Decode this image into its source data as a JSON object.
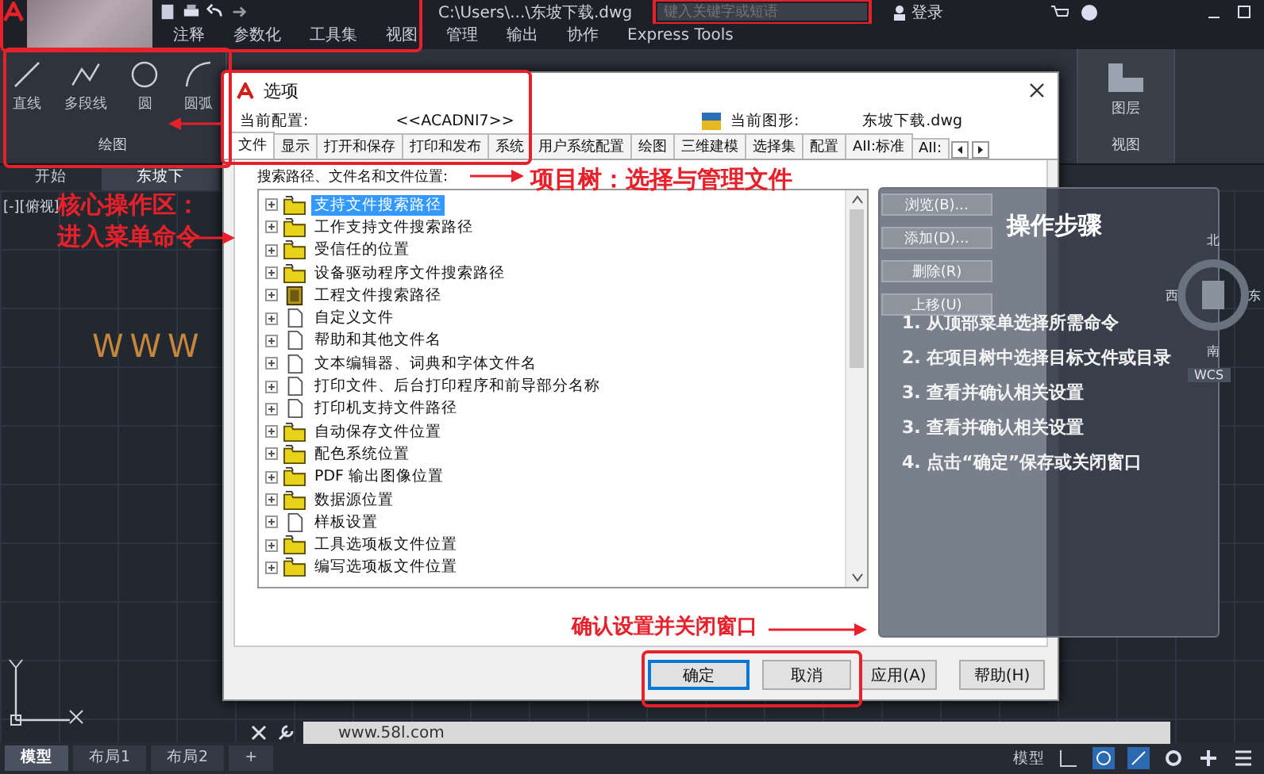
{
  "app": {
    "title": "C:\\Users\\...\\东坡下载.dwg",
    "search_placeholder": "键入关键字或短语",
    "login": "登录"
  },
  "ribbon_tabs": [
    {
      "label": "注释",
      "selected": false
    },
    {
      "label": "参数化",
      "selected": false
    },
    {
      "label": "工具集",
      "selected": false
    },
    {
      "label": "视图",
      "selected": false
    },
    {
      "label": "管理",
      "selected": false
    },
    {
      "label": "输出",
      "selected": false
    },
    {
      "label": "协作",
      "selected": false
    },
    {
      "label": "Express Tools",
      "selected": false
    }
  ],
  "draw_tools": [
    {
      "label": "直线",
      "kind": "line"
    },
    {
      "label": "多段线",
      "kind": "polyline"
    },
    {
      "label": "圆",
      "kind": "circle"
    },
    {
      "label": "圆弧",
      "kind": "arc"
    }
  ],
  "draw_panel": "绘图",
  "view_panel": {
    "button": "图层",
    "label": "视图"
  },
  "file_tabs": [
    {
      "label": "开始",
      "selected": false
    },
    {
      "label": "东坡下",
      "selected": true
    }
  ],
  "viewport_label": "[-][俯视]",
  "canvas_text": "WWW",
  "dialog": {
    "title": "选项",
    "profile_label": "当前配置:",
    "profile": "<<ACADNI7>>",
    "drawing_label": "当前图形:",
    "drawing": "东坡下载.dwg",
    "tabs": [
      {
        "label": "文件",
        "selected": true
      },
      {
        "label": "显示",
        "selected": false
      },
      {
        "label": "打开和保存",
        "selected": false
      },
      {
        "label": "打印和发布",
        "selected": false
      },
      {
        "label": "系统",
        "selected": false
      },
      {
        "label": "用户系统配置",
        "selected": false
      },
      {
        "label": "绘图",
        "selected": false
      },
      {
        "label": "三维建模",
        "selected": false
      },
      {
        "label": "选择集",
        "selected": false
      },
      {
        "label": "配置",
        "selected": false
      },
      {
        "label": "AII:标准",
        "selected": false
      },
      {
        "label": "AII:",
        "selected": false
      }
    ],
    "tree_label": "搜索路径、文件名和文件位置:",
    "tree": [
      {
        "label": "支持文件搜索路径",
        "kind": "folder",
        "selected": true
      },
      {
        "label": "工作支持文件搜索路径",
        "kind": "folder",
        "selected": false
      },
      {
        "label": "受信任的位置",
        "kind": "folder",
        "selected": false
      },
      {
        "label": "设备驱动程序文件搜索路径",
        "kind": "folder",
        "selected": false
      },
      {
        "label": "工程文件搜索路径",
        "kind": "book",
        "selected": false
      },
      {
        "label": "自定义文件",
        "kind": "doc",
        "selected": false
      },
      {
        "label": "帮助和其他文件名",
        "kind": "doc",
        "selected": false
      },
      {
        "label": "文本编辑器、词典和字体文件名",
        "kind": "doc",
        "selected": false
      },
      {
        "label": "打印文件、后台打印程序和前导部分名称",
        "kind": "doc",
        "selected": false
      },
      {
        "label": "打印机支持文件路径",
        "kind": "doc",
        "selected": false
      },
      {
        "label": "自动保存文件位置",
        "kind": "folder",
        "selected": false
      },
      {
        "label": "配色系统位置",
        "kind": "folder",
        "selected": false
      },
      {
        "label": "PDF 输出图像位置",
        "kind": "folder",
        "selected": false
      },
      {
        "label": "数据源位置",
        "kind": "folder",
        "selected": false
      },
      {
        "label": "样板设置",
        "kind": "doc",
        "selected": false
      },
      {
        "label": "工具选项板文件位置",
        "kind": "folder",
        "selected": false
      },
      {
        "label": "编写选项板文件位置",
        "kind": "folder",
        "selected": false
      }
    ],
    "side_buttons": [
      "浏览(B)...",
      "添加(D)...",
      "删除(R)",
      "上移(U)"
    ],
    "buttons": [
      {
        "label": "确定",
        "kind": "default"
      },
      {
        "label": "取消",
        "kind": "normal"
      },
      {
        "label": "应用(A)",
        "kind": "normal"
      },
      {
        "label": "帮助(H)",
        "kind": "normal"
      }
    ]
  },
  "steps_panel": {
    "title": "操作步骤",
    "steps": [
      "1. 从顶部菜单选择所需命令",
      "2. 在项目树中选择目标文件或目录",
      "3. 查看并确认相关设置",
      "3. 查看并确认相关设置",
      "4. 点击“确定”保存或关闭窗口"
    ]
  },
  "annotations": {
    "core_area": "核心操作区：",
    "core_area_hint": "进入菜单命令",
    "project_tree": "项目树：选择与管理文件",
    "confirm": "确认设置并关闭窗口"
  },
  "viewcube": {
    "north": "北",
    "west": "西",
    "east": "东",
    "south": "南",
    "wcs": "WCS"
  },
  "command_line": "www.58l.com",
  "layout_tabs": [
    {
      "label": "模型",
      "selected": true
    },
    {
      "label": "布局1",
      "selected": false
    },
    {
      "label": "布局2",
      "selected": false
    },
    {
      "label": "+",
      "selected": false
    }
  ],
  "status_mode": "模型"
}
